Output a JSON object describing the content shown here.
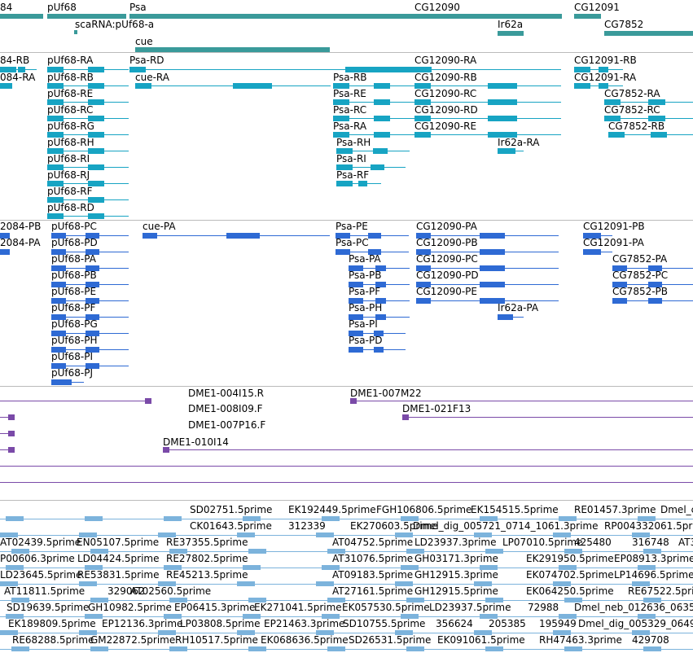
{
  "colors": {
    "gene": "#3a9a9a",
    "transcript": "#17a4c3",
    "cds": "#2e6ad4",
    "clone": "#7a4aa8",
    "est": "#7cb3dc"
  },
  "tracks": {
    "genes": [
      {
        "label": "84",
        "name": "gene-label-84"
      },
      {
        "label": "pUf68",
        "name": "gene-label-puf68"
      },
      {
        "label": "Psa",
        "name": "gene-label-psa"
      },
      {
        "label": "CG12090",
        "name": "gene-label-cg12090"
      },
      {
        "label": "CG12091",
        "name": "gene-label-cg12091"
      },
      {
        "label": "scaRNA:pUf68-a",
        "name": "gene-label-scarna"
      },
      {
        "label": "Ir62a",
        "name": "gene-label-ir62a"
      },
      {
        "label": "CG7852",
        "name": "gene-label-cg7852"
      },
      {
        "label": "cue",
        "name": "gene-label-cue"
      }
    ],
    "transcripts": [
      "84-RB",
      "pUf68-RA",
      "Psa-RD",
      "CG12090-RA",
      "CG12091-RB",
      "084-RA",
      "pUf68-RB",
      "cue-RA",
      "Psa-RB",
      "CG12090-RB",
      "CG12091-RA",
      "pUf68-RE",
      "Psa-RE",
      "CG12090-RC",
      "CG7852-RA",
      "pUf68-RC",
      "Psa-RC",
      "CG12090-RD",
      "CG7852-RC",
      "pUf68-RG",
      "Psa-RA",
      "CG12090-RE",
      "CG7852-RB",
      "pUf68-RH",
      "Psa-RH",
      "Ir62a-RA",
      "pUf68-RI",
      "Psa-RI",
      "pUf68-RJ",
      "Psa-RF",
      "pUf68-RF",
      "pUf68-RD"
    ],
    "cds": [
      "2084-PB",
      "pUf68-PC",
      "cue-PA",
      "Psa-PE",
      "CG12090-PA",
      "CG12091-PB",
      "2084-PA",
      "pUf68-PD",
      "Psa-PC",
      "CG12090-PB",
      "CG12091-PA",
      "pUf68-PA",
      "Psa-PA",
      "CG12090-PC",
      "CG7852-PA",
      "pUf68-PB",
      "Psa-PB",
      "CG12090-PD",
      "CG7852-PC",
      "pUf68-PE",
      "Psa-PF",
      "CG12090-PE",
      "CG7852-PB",
      "pUf68-PF",
      "Psa-PH",
      "Ir62a-PA",
      "pUf68-PG",
      "Psa-PI",
      "pUf68-PH",
      "Psa-PD",
      "pUf68-PI",
      "pUf68-PJ"
    ],
    "clones": [
      "DME1-004I15.R",
      "DME1-007M22",
      "DME1-008I09.F",
      "DME1-021F13",
      "DME1-007P16.F",
      "DME1-010I14"
    ],
    "ests": [
      "SD02751.5prime",
      "EK192449.5prime",
      "FGH106806.5prime",
      "EK154515.5prime",
      "RE01457.3prime",
      "Dmel_c",
      "CK01643.5prime",
      "312339",
      "EK270603.5prime",
      "Dmel_dig_005721_0714_1061.3prime",
      "RP004332061.5prime",
      "AT02439.5prime",
      "EN05107.5prime",
      "RE37355.5prime",
      "AT04752.5prime",
      "LD23937.3prime",
      "LP07010.5prime",
      "425480",
      "316748",
      "AT3",
      "P00606.3prime",
      "LD04424.5prime",
      "RE27802.5prime",
      "AT31076.5prime",
      "GH03171.3prime",
      "EK291950.5prime",
      "EP08913.3prime",
      "LD23645.5prime",
      "RE53831.5prime",
      "RE45213.5prime",
      "AT09183.5prime",
      "GH12915.3prime",
      "EK074702.5prime",
      "LP14696.5prime",
      "AT11811.5prime",
      "329062",
      "AT02560.5prime",
      "AT27161.5prime",
      "GH12915.5prime",
      "EK064250.5prime",
      "RE67522.5prime",
      "SD19639.5prime",
      "GH10982.5prime",
      "EP06415.3prime",
      "EK271041.5prime",
      "EK057530.5prime",
      "LD23937.5prime",
      "72988",
      "Dmel_neb_012636_0635",
      "EK189809.5prime",
      "EP12136.3prime",
      "LP03808.5prime",
      "EP21463.3prime",
      "SD10755.5prime",
      "356624",
      "205385",
      "195949",
      "Dmel_dig_005329_0649",
      "RE68288.5prime",
      "GM22872.5prime",
      "RH10517.5prime",
      "EK068636.5prime",
      "SD26531.5prime",
      "EK091061.5prime",
      "RH47463.3prime",
      "429708"
    ]
  }
}
